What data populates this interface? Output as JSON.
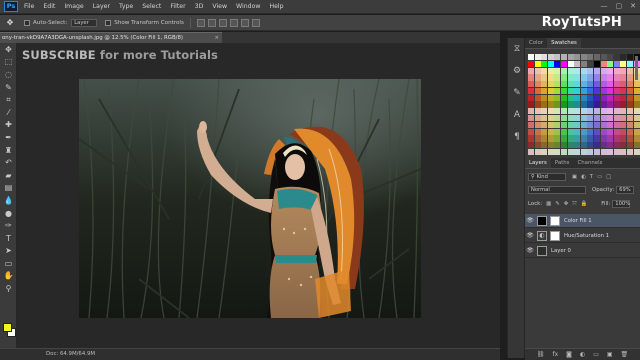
{
  "app": {
    "logo": "Ps"
  },
  "menu": [
    "File",
    "Edit",
    "Image",
    "Layer",
    "Type",
    "Select",
    "Filter",
    "3D",
    "View",
    "Window",
    "Help"
  ],
  "window_controls": [
    "—",
    "▢",
    "✕"
  ],
  "options": {
    "auto_select_label": "Auto-Select:",
    "auto_select_value": "Layer",
    "transform_label": "Show Transform Controls"
  },
  "brand": "RoyTutsPH",
  "document": {
    "tab_title": "ony-tran-vkD9A7A3DGA-unsplash.jpg @ 12.5% (Color Fill 1, RGB/8)",
    "close": "×"
  },
  "overlay_text": {
    "bold": "SUBSCRIBE",
    "rest": " for more Tutorials"
  },
  "status": {
    "zoom": "",
    "doc": "Doc: 64.9M/64.9M"
  },
  "panels": {
    "color_tabs": [
      "Color",
      "Swatches"
    ],
    "layer_tabs": [
      "Layers",
      "Paths",
      "Channels"
    ],
    "kind_label": "Kind",
    "blend_mode": "Normal",
    "opacity_label": "Opacity:",
    "opacity_value": "69%",
    "lock_label": "Lock:",
    "fill_label": "Fill:",
    "fill_value": "100%",
    "layers": [
      {
        "name": "Color Fill 1",
        "selected": true
      },
      {
        "name": "Hue/Saturation 1",
        "selected": false
      },
      {
        "name": "Layer 0",
        "selected": false
      }
    ],
    "footer_icons": [
      "link-icon",
      "fx-icon",
      "mask-icon",
      "adjustment-icon",
      "folder-icon",
      "new-layer-icon",
      "trash-icon"
    ]
  },
  "colors": {
    "foreground": "#f3f32a",
    "background": "#ffffff",
    "accent": "#31a8ff"
  }
}
